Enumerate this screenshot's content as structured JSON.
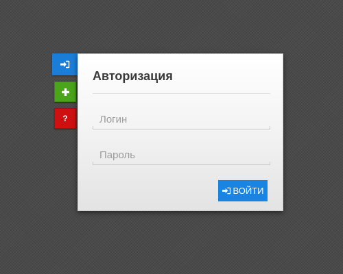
{
  "side_tabs": {
    "login": {
      "icon": "sign-in-icon",
      "color": "#1a7ed8"
    },
    "register": {
      "icon": "plus-icon",
      "color": "#4aa51b"
    },
    "help": {
      "icon": "question-icon",
      "label": "?",
      "color": "#cf1010"
    }
  },
  "login_panel": {
    "title": "Авторизация",
    "login_field": {
      "value": "",
      "placeholder": "Логин"
    },
    "password_field": {
      "value": "",
      "placeholder": "Пароль"
    },
    "submit_button": {
      "label": "ВОЙТИ",
      "icon": "sign-in-icon",
      "color": "#1a84e3"
    }
  }
}
